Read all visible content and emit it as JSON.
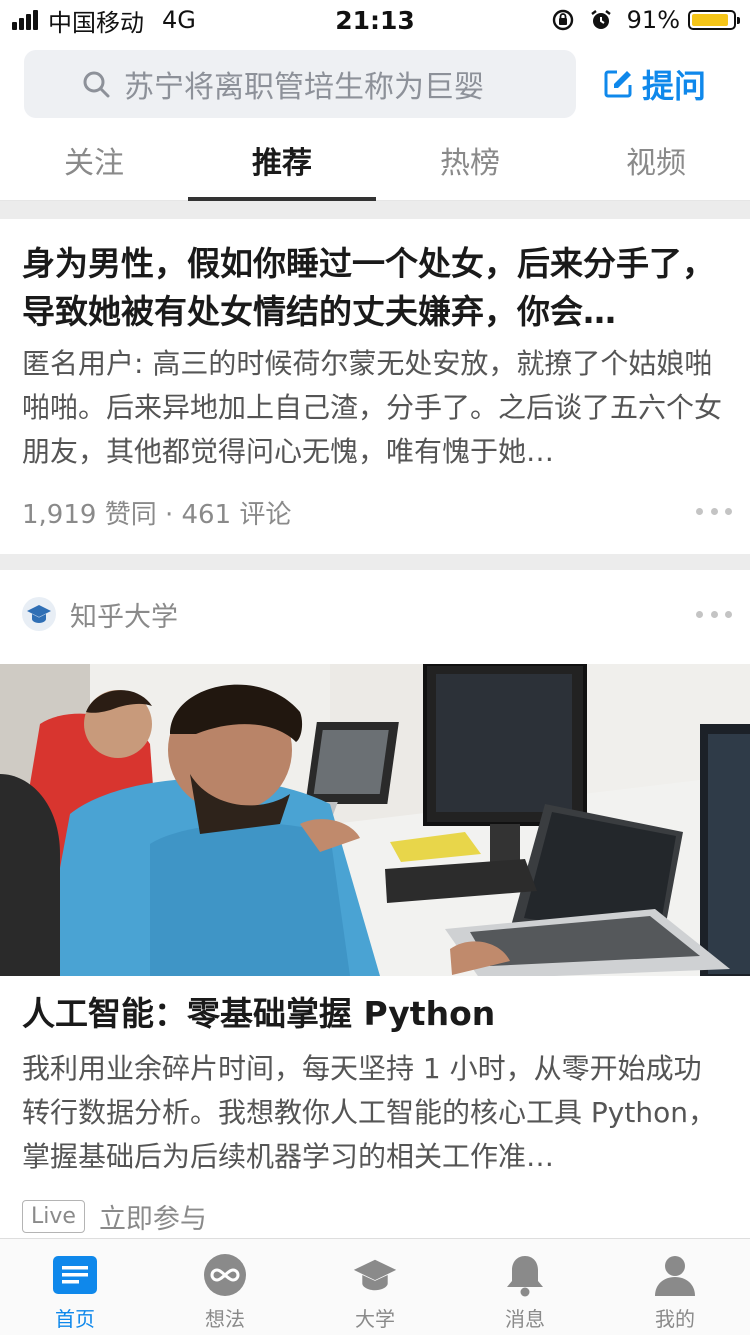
{
  "status_bar": {
    "carrier": "中国移动",
    "network": "4G",
    "time": "21:13",
    "battery": "91%",
    "battery_level": 0.91
  },
  "search": {
    "placeholder": "苏宁将离职管培生称为巨婴",
    "ask_label": "提问"
  },
  "tabs": [
    {
      "label": "关注",
      "active": false
    },
    {
      "label": "推荐",
      "active": true
    },
    {
      "label": "热榜",
      "active": false
    },
    {
      "label": "视频",
      "active": false
    }
  ],
  "feed": [
    {
      "title": "身为男性，假如你睡过一个处女，后来分手了，导致她被有处女情结的丈夫嫌弃，你会…",
      "excerpt": "匿名用户: 高三的时候荷尔蒙无处安放，就撩了个姑娘啪啪啪。后来异地加上自己渣，分手了。之后谈了五六个女朋友，其他都觉得问心无愧，唯有愧于她…",
      "meta": "1,919 赞同 · 461 评论"
    },
    {
      "source": "知乎大学",
      "source_icon": "graduation-cap-icon",
      "title": "人工智能：零基础掌握 Python",
      "excerpt": "我利用业余碎片时间，每天坚持 1 小时，从零开始成功转行数据分析。我想教你人工智能的核心工具 Python，掌握基础后为后续机器学习的相关工作准…",
      "badge": "Live",
      "action": "立即参与"
    }
  ],
  "bottom_nav": [
    {
      "label": "首页",
      "icon": "home-icon",
      "active": true
    },
    {
      "label": "想法",
      "icon": "idea-icon",
      "active": false
    },
    {
      "label": "大学",
      "icon": "graduation-cap-icon",
      "active": false
    },
    {
      "label": "消息",
      "icon": "bell-icon",
      "active": false
    },
    {
      "label": "我的",
      "icon": "profile-icon",
      "active": false
    }
  ],
  "colors": {
    "accent": "#0f88eb",
    "battery": "#f5c518",
    "muted": "#8a8a8a"
  }
}
